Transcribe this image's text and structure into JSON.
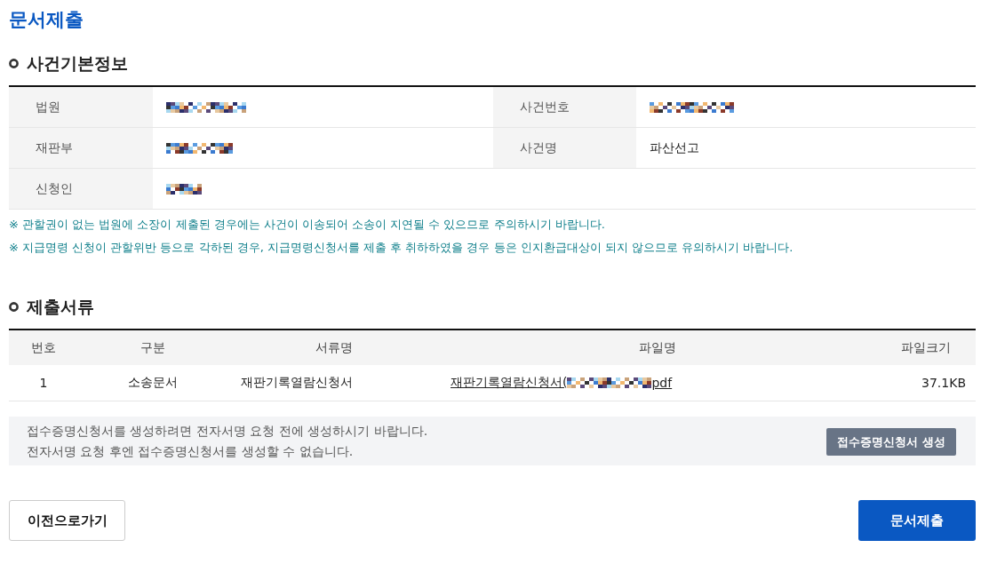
{
  "page_title": "문서제출",
  "case_info": {
    "heading": "사건기본정보",
    "rows": [
      {
        "fields": [
          {
            "label": "법원",
            "redacted": true
          },
          {
            "label": "사건번호",
            "redacted": true
          }
        ]
      },
      {
        "fields": [
          {
            "label": "재판부",
            "redacted": true
          },
          {
            "label": "사건명",
            "redacted": false,
            "value": "파산선고"
          }
        ]
      },
      {
        "fields": [
          {
            "label": "신청인",
            "redacted": true
          }
        ]
      }
    ]
  },
  "notices": [
    "※ 관할권이 없는 법원에 소장이 제출된 경우에는 사건이 이송되어 소송이 지연될 수 있으므로 주의하시기 바랍니다.",
    "※ 지급명령 신청이 관할위반 등으로 각하된 경우, 지급명령신청서를 제출 후 취하하였을 경우 등은 인지환급대상이 되지 않으므로 유의하시기 바랍니다."
  ],
  "documents": {
    "heading": "제출서류",
    "columns": [
      "번호",
      "구분",
      "서류명",
      "파일명",
      "파일크기"
    ],
    "rows": [
      {
        "number": "1",
        "category": "소송문서",
        "document": "재판기록열람신청서",
        "file": {
          "segments": [
            {
              "kind": "text",
              "text": "재판기록열람신청서("
            },
            {
              "kind": "redacted"
            },
            {
              "kind": "text",
              "text": "pdf"
            }
          ]
        },
        "size": "37.1KB"
      }
    ]
  },
  "receipt": {
    "lines": [
      "접수증명신청서를 생성하려면 전자서명 요청 전에 생성하시기 바랍니다.",
      "전자서명 요청 후엔 접수증명신청서를 생성할 수 없습니다."
    ],
    "button": "접수증명신청서 생성"
  },
  "back_button": "이전으로가기",
  "submit_button": "문서제출"
}
